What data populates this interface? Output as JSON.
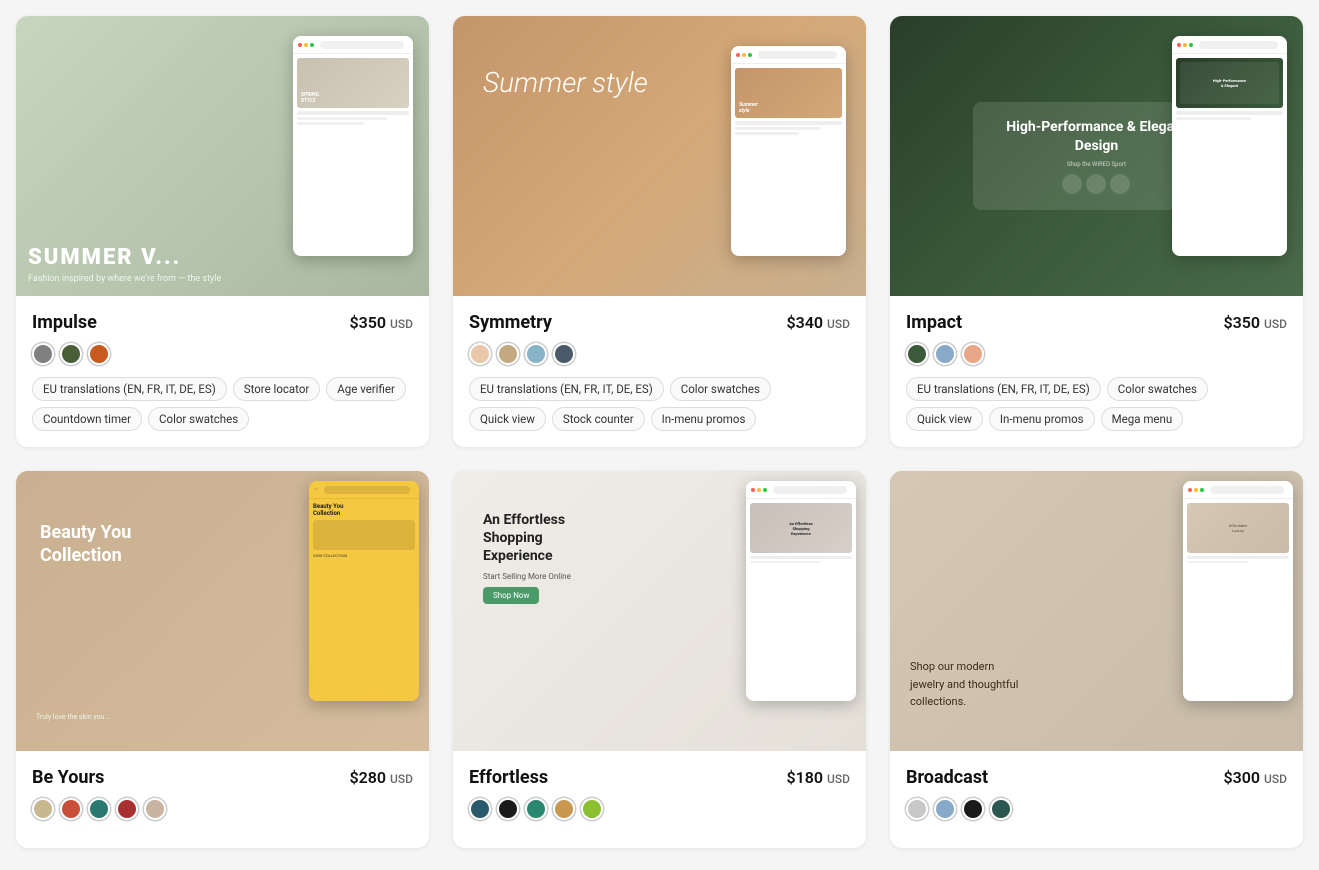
{
  "cards": [
    {
      "id": "impulse",
      "title": "Impulse",
      "price": "$350",
      "currency": "USD",
      "swatches": [
        "#808080",
        "#4a5e3a",
        "#c85a20"
      ],
      "tags": [
        "EU translations (EN, FR, IT, DE, ES)",
        "Store locator",
        "Age verifier",
        "Countdown timer",
        "Color swatches"
      ],
      "mockType": "impulse",
      "mockBgClass": "img-impulse"
    },
    {
      "id": "symmetry",
      "title": "Symmetry",
      "price": "$340",
      "currency": "USD",
      "swatches": [
        "#e8c8a8",
        "#c4a882",
        "#88b4c8",
        "#4a5a6a"
      ],
      "tags": [
        "EU translations (EN, FR, IT, DE, ES)",
        "Color swatches",
        "Quick view",
        "Stock counter",
        "In-menu promos"
      ],
      "mockType": "symmetry",
      "mockBgClass": "img-symmetry"
    },
    {
      "id": "impact",
      "title": "Impact",
      "price": "$350",
      "currency": "USD",
      "swatches": [
        "#3a5a3a",
        "#88aac8",
        "#e8a888"
      ],
      "tags": [
        "EU translations (EN, FR, IT, DE, ES)",
        "Color swatches",
        "Quick view",
        "In-menu promos",
        "Mega menu"
      ],
      "mockType": "impact",
      "mockBgClass": "img-impact"
    },
    {
      "id": "beyours",
      "title": "Be Yours",
      "price": "$280",
      "currency": "USD",
      "swatches": [
        "#c8b890",
        "#c8503a",
        "#2a7870",
        "#a83030",
        "#c8b4a0"
      ],
      "tags": [],
      "mockType": "beyours",
      "mockBgClass": "img-beyours"
    },
    {
      "id": "effortless",
      "title": "Effortless",
      "price": "$180",
      "currency": "USD",
      "swatches": [
        "#2a5a6a",
        "#1a1a1a",
        "#2a8870",
        "#c89850",
        "#8abf30"
      ],
      "tags": [],
      "mockType": "effortless",
      "mockBgClass": "img-effortless"
    },
    {
      "id": "broadcast",
      "title": "Broadcast",
      "price": "$300",
      "currency": "USD",
      "swatches": [
        "#c8c8c8",
        "#88aac8",
        "#1a1a1a",
        "#2a5850"
      ],
      "tags": [],
      "mockType": "broadcast",
      "mockBgClass": "img-broadcast"
    }
  ]
}
